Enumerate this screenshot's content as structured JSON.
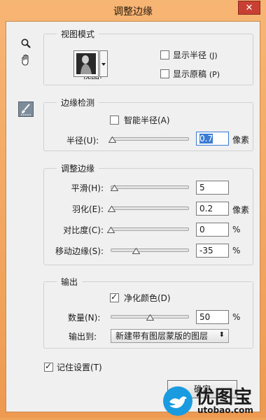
{
  "window": {
    "title": "调整边缘",
    "close_glyph": "✕"
  },
  "tools": {
    "zoom": "zoom-icon",
    "hand": "hand-icon",
    "brush": "refine-radius-brush-icon"
  },
  "view_mode": {
    "title": "视图模式",
    "view_label": "视图:",
    "show_radius": {
      "label": "显示半径",
      "shortcut": "(J)",
      "checked": false
    },
    "show_original": {
      "label": "显示原稿",
      "shortcut": "(P)",
      "checked": false
    }
  },
  "edge_detection": {
    "title": "边缘检测",
    "smart_radius": {
      "label": "智能半径(A)",
      "checked": false
    },
    "radius": {
      "label": "半径(U):",
      "value": "0.7",
      "unit": "像素",
      "slider_fraction": 0.02
    }
  },
  "adjust_edge": {
    "title": "调整边缘",
    "smooth": {
      "label": "平滑(H):",
      "value": "5",
      "unit": "",
      "slider_fraction": 0.05
    },
    "feather": {
      "label": "羽化(E):",
      "value": "0.2",
      "unit": "像素",
      "slider_fraction": 0.01
    },
    "contrast": {
      "label": "对比度(C):",
      "value": "0",
      "unit": "%",
      "slider_fraction": 0.0
    },
    "shift_edge": {
      "label": "移动边缘(S):",
      "value": "-35",
      "unit": "%",
      "slider_fraction": 0.325
    }
  },
  "output": {
    "title": "输出",
    "decontaminate": {
      "label": "净化颜色(D)",
      "checked": true
    },
    "amount": {
      "label": "数量(N):",
      "value": "50",
      "unit": "%",
      "slider_fraction": 0.5
    },
    "output_to_label": "输出到:",
    "output_to_value": "新建带有图层蒙版的图层"
  },
  "remember": {
    "label": "记住设置(T)",
    "checked": true
  },
  "buttons": {
    "ok": "确定"
  },
  "watermark": {
    "text": "优图宝",
    "url": "utobao.com"
  }
}
